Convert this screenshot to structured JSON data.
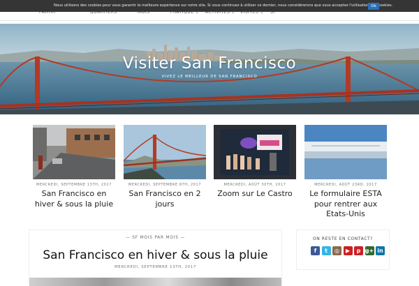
{
  "nav": {
    "items": [
      {
        "label": "Partir",
        "has_menu": false
      },
      {
        "label": "Quartiers",
        "has_menu": false
      },
      {
        "label": "Mois",
        "has_menu": false
      },
      {
        "label": "Pratique",
        "has_menu": true
      },
      {
        "label": "Activités",
        "has_menu": true
      },
      {
        "label": "Visites",
        "has_menu": true
      },
      {
        "label": "SF",
        "has_menu": false
      }
    ]
  },
  "cookie_banner": {
    "message": "Nous utilisons des cookies pour vous garantir la meilleure expérience sur notre site. Si vous continuez à utiliser ce dernier, nous considérerons que vous acceptez l'utilisation des cookies.",
    "ok_label": "Ok"
  },
  "hero": {
    "title": "Visiter San Francisco",
    "subtitle": "Vivez le meilleur de San Francisco"
  },
  "posts": [
    {
      "date": "Mercredi, septembre 13th, 2017",
      "title": "San Francisco en hiver & sous la pluie"
    },
    {
      "date": "Mercredi, septembre 6th, 2017",
      "title": "San Francisco en 2 jours"
    },
    {
      "date": "Mercredi, août 30th, 2017",
      "title": "Zoom sur Le Castro"
    },
    {
      "date": "Mercredi, août 23rd, 2017",
      "title": "Le formulaire ESTA pour rentrer aux Etats-Unis"
    }
  ],
  "article": {
    "kicker": "SF mois par mois",
    "title": "San Francisco en hiver & sous la pluie",
    "date": "Mercredi, septembre 13th, 2017"
  },
  "sidebar": {
    "widget_title": "On reste en contact?",
    "social": [
      {
        "icon": "facebook-icon",
        "glyph": "f",
        "color": "#3b5998"
      },
      {
        "icon": "twitter-icon",
        "glyph": "t",
        "color": "#33b5e5"
      },
      {
        "icon": "instagram-icon",
        "glyph": "◎",
        "color": "#8a6a4f"
      },
      {
        "icon": "youtube-icon",
        "glyph": "▶",
        "color": "#cc2020"
      },
      {
        "icon": "pinterest-icon",
        "glyph": "p",
        "color": "#cb2027"
      },
      {
        "icon": "google-plus-icon",
        "glyph": "g+",
        "color": "#2f6a2f"
      },
      {
        "icon": "linkedin-icon",
        "glyph": "in",
        "color": "#0e76a8"
      }
    ]
  }
}
